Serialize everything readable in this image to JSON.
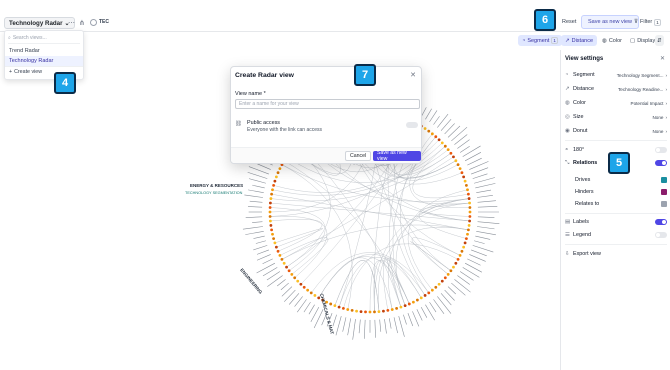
{
  "header": {
    "view_name": "Technology Radar",
    "tec_label": "TEC",
    "reset_label": "Reset",
    "save_new_label": "Save as new view",
    "filter_label": "Filter",
    "filter_count": "1"
  },
  "toolbar": {
    "segment_label": "Segment",
    "segment_count": "1",
    "distance_label": "Distance",
    "color_label": "Color",
    "display_label": "Display"
  },
  "dropdown": {
    "search_placeholder": "Search views...",
    "items": [
      "Trend Radar",
      "Technology Radar"
    ],
    "create_label": "Create view"
  },
  "markers": {
    "m4": "4",
    "m5": "5",
    "m6": "6",
    "m7": "7"
  },
  "radar": {
    "sector_labels": [
      "ENERGY & RESOURCES",
      "ENGINEERING",
      "CHEMICALS & MAT",
      "TECHNOLOGY SEGMENTATION"
    ]
  },
  "modal": {
    "title": "Create Radar view",
    "name_label": "View name *",
    "name_placeholder": "Enter a name for your view",
    "public_title": "Public access",
    "public_desc": "Everyone with the link can access",
    "cancel_label": "Cancel",
    "save_label": "Save as new view"
  },
  "panel": {
    "title": "View settings",
    "segment_label": "Segment",
    "segment_value": "Technology Segment...",
    "distance_label": "Distance",
    "distance_value": "Technology Readine...",
    "color_label": "Color",
    "color_value": "Potential Impact",
    "size_label": "Size",
    "size_value": "None",
    "donut_label": "Donut",
    "donut_value": "None",
    "deg_label": "180°",
    "relations_label": "Relations",
    "drives_label": "Drives",
    "hinders_label": "Hinders",
    "relates_label": "Relates to",
    "labels_label": "Labels",
    "legend_label": "Legend",
    "export_label": "Export view",
    "colors": {
      "drives": "#1a8fa0",
      "hinders": "#8b1d6b",
      "relates": "#9ca3af",
      "accent": "#4f46e5"
    }
  }
}
